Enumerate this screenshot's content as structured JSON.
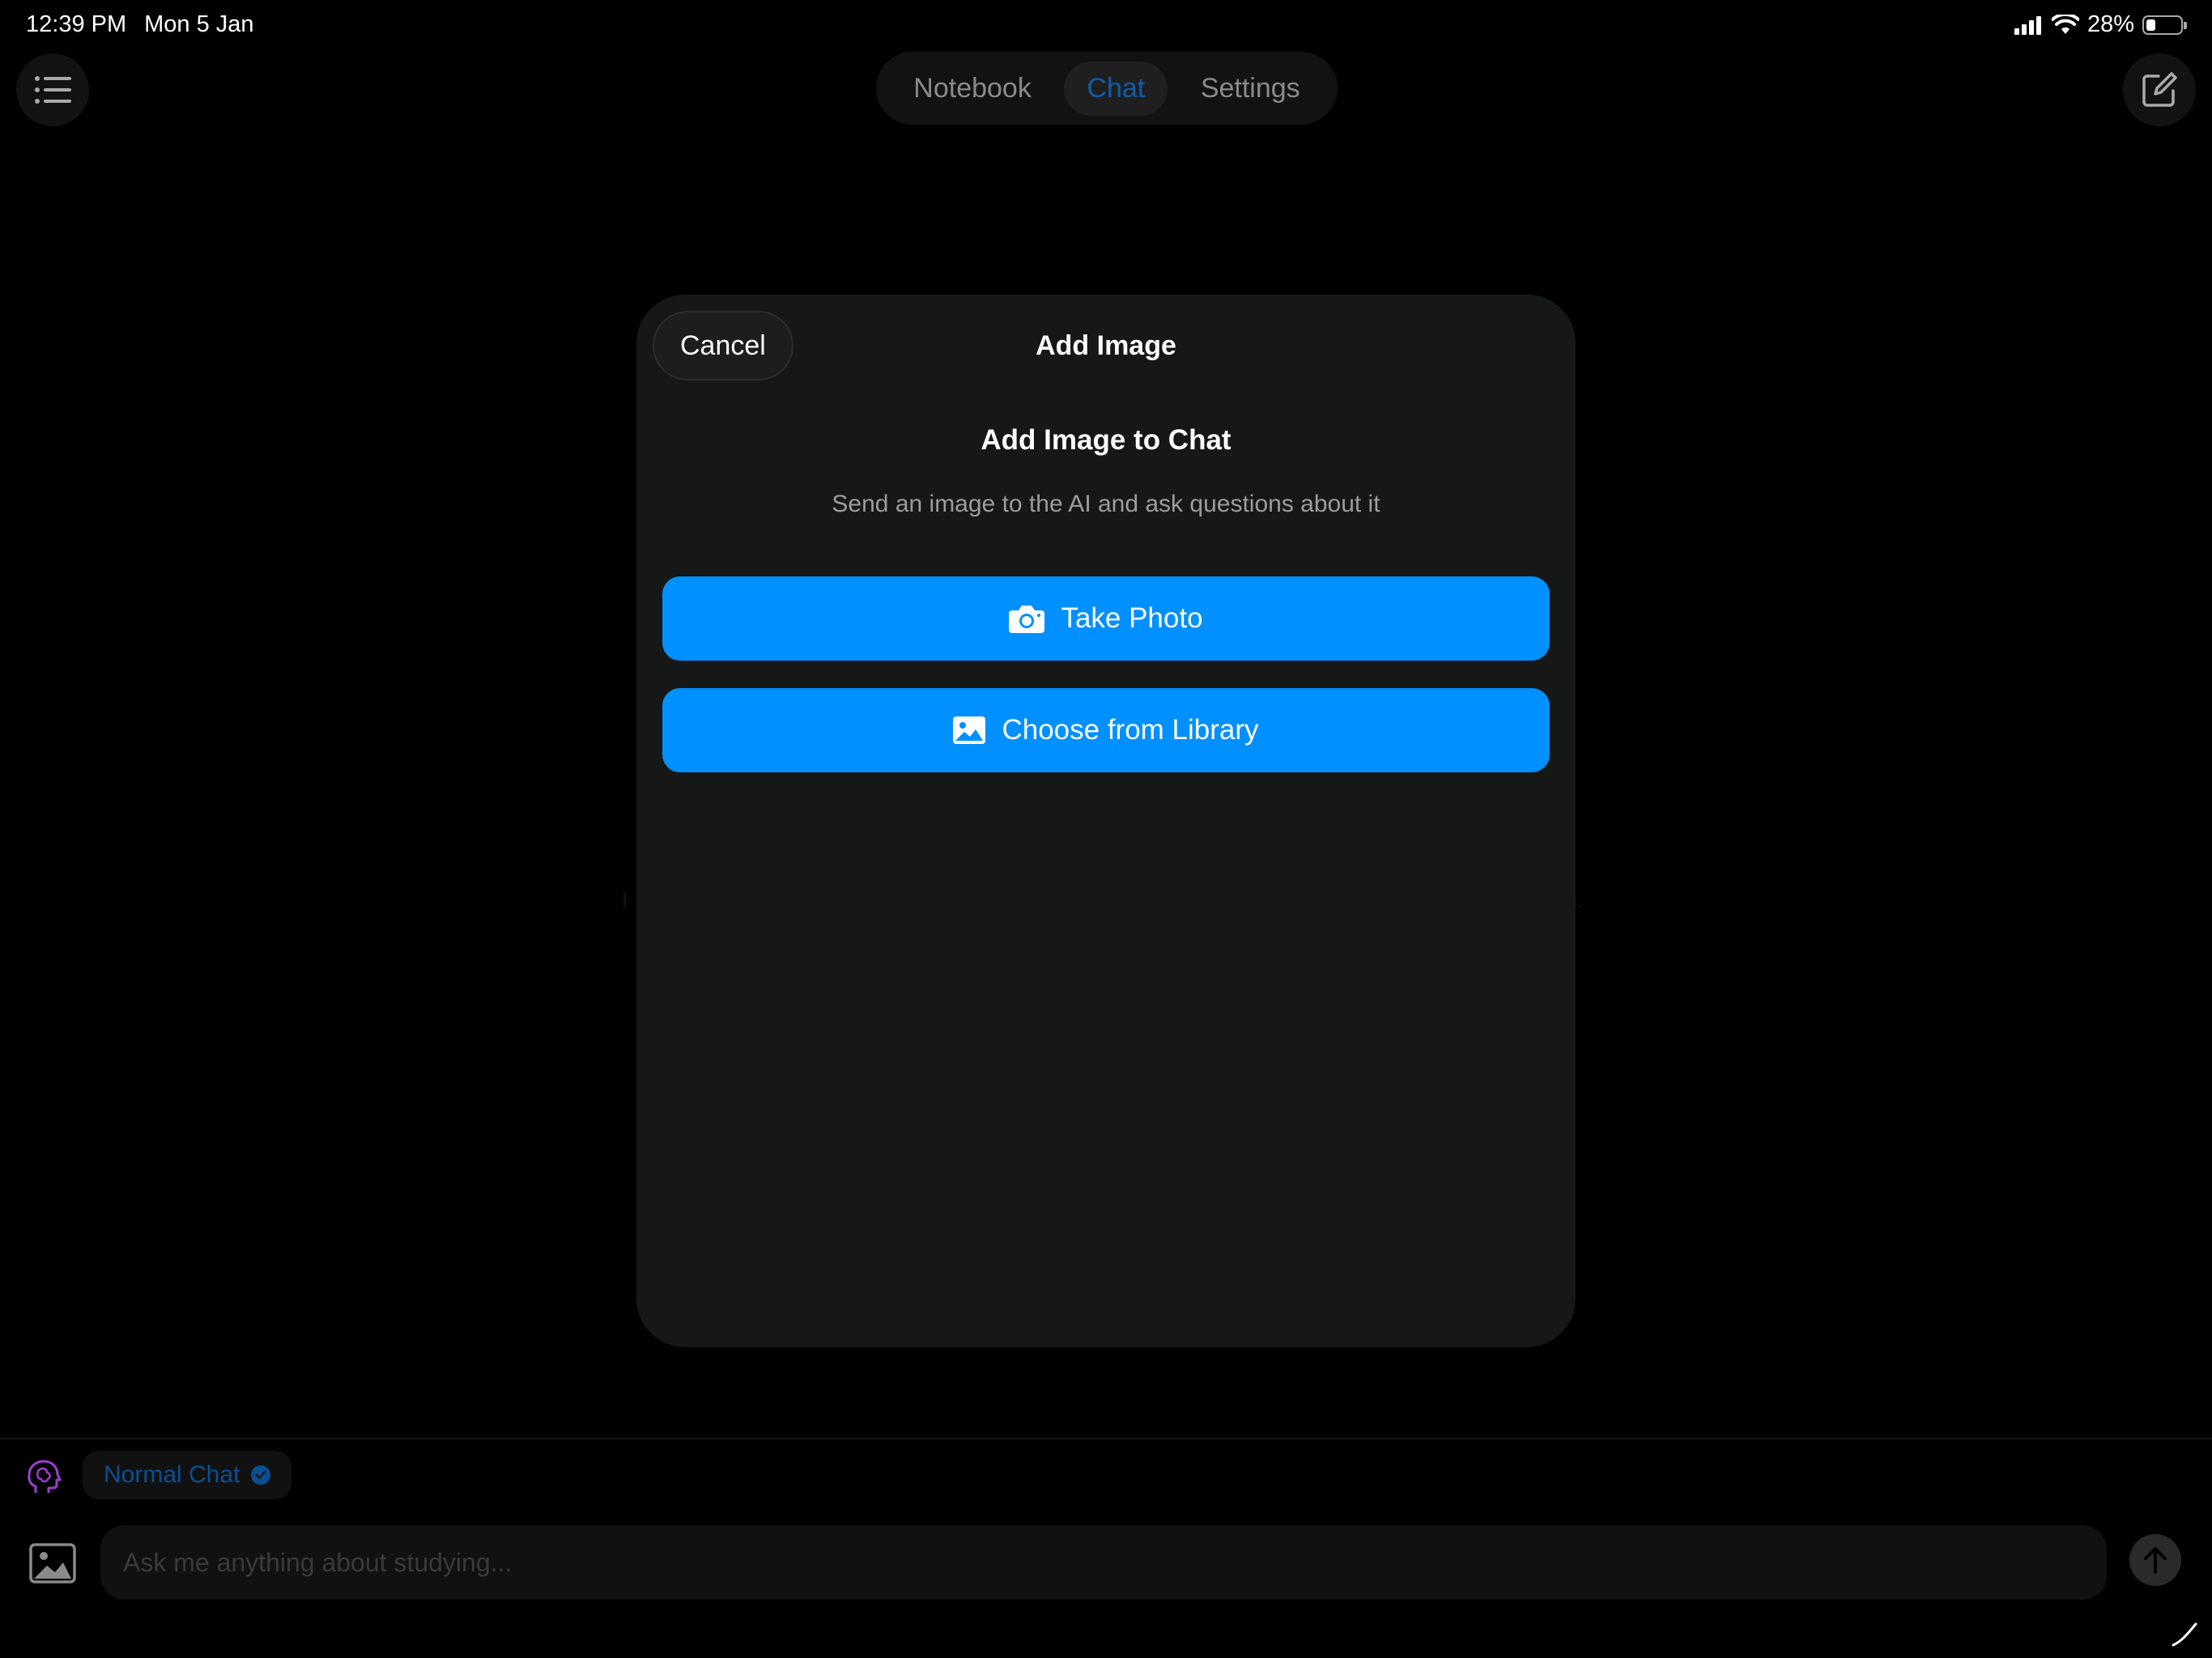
{
  "status_bar": {
    "time": "12:39 PM",
    "date": "Mon 5 Jan",
    "battery": "28%",
    "battery_level": 0.28
  },
  "nav": {
    "tabs": [
      {
        "label": "Notebook"
      },
      {
        "label": "Chat"
      },
      {
        "label": "Settings"
      }
    ],
    "active_tab": "Chat"
  },
  "background": {
    "left_fragment": "I",
    "right_fragment": "s."
  },
  "modal": {
    "cancel_label": "Cancel",
    "title": "Add Image",
    "heading": "Add Image to Chat",
    "subtitle": "Send an image to the AI and ask questions about it",
    "take_photo_label": "Take Photo",
    "library_label": "Choose from Library"
  },
  "composer": {
    "mode_label": "Normal Chat",
    "placeholder": "Ask me anything about studying..."
  },
  "colors": {
    "accent": "#0090ff",
    "active_tab": "#0f5cab",
    "mode": "#0a4f93",
    "brain": "#9b3fd0"
  }
}
